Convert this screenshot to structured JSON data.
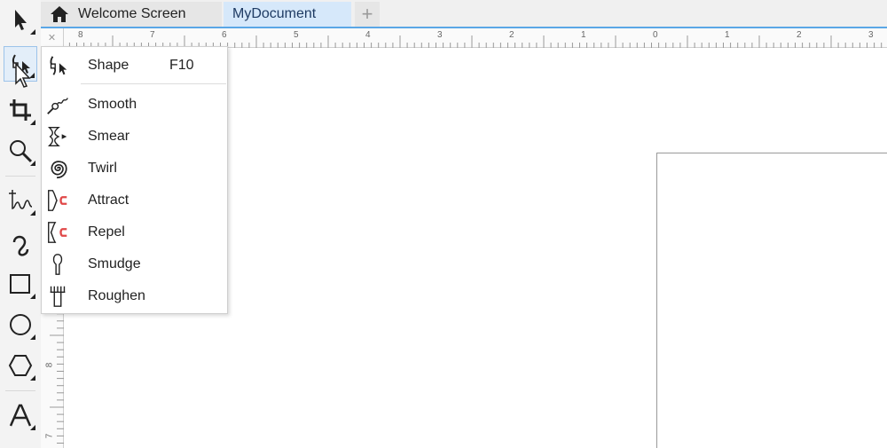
{
  "tabs": [
    {
      "label": "Welcome Screen",
      "icon": "home-icon"
    },
    {
      "label": "MyDocument"
    },
    {
      "label": "+",
      "icon": "add-tab-icon"
    }
  ],
  "ruler": {
    "top_numbers": [
      "8",
      "7",
      "6",
      "5",
      "4",
      "3",
      "2",
      "1",
      "0",
      "1",
      "2",
      "3"
    ],
    "left_numbers": [
      "8",
      "7"
    ]
  },
  "toolbox": [
    {
      "name": "pick-tool",
      "icon": "arrow-pointer-icon"
    },
    {
      "name": "shape-tool",
      "icon": "shape-node-icon",
      "active": true
    },
    {
      "name": "crop-tool",
      "icon": "crop-icon"
    },
    {
      "name": "zoom-tool",
      "icon": "magnifier-icon"
    },
    {
      "name": "freehand-tool",
      "icon": "freehand-icon"
    },
    {
      "name": "artistic-media-tool",
      "icon": "curve-icon"
    },
    {
      "name": "rectangle-tool",
      "icon": "rectangle-icon"
    },
    {
      "name": "ellipse-tool",
      "icon": "ellipse-icon"
    },
    {
      "name": "polygon-tool",
      "icon": "hexagon-icon"
    },
    {
      "name": "text-tool",
      "icon": "text-a-icon"
    }
  ],
  "flyout": {
    "items": [
      {
        "label": "Shape",
        "shortcut": "F10",
        "icon": "shape-node-icon"
      },
      {
        "label": "Smooth",
        "icon": "smooth-icon"
      },
      {
        "label": "Smear",
        "icon": "smear-icon"
      },
      {
        "label": "Twirl",
        "icon": "twirl-icon"
      },
      {
        "label": "Attract",
        "icon": "attract-magnet-icon"
      },
      {
        "label": "Repel",
        "icon": "repel-magnet-icon"
      },
      {
        "label": "Smudge",
        "icon": "smudge-icon"
      },
      {
        "label": "Roughen",
        "icon": "roughen-icon"
      }
    ]
  },
  "colors": {
    "accent": "#5aa7e6",
    "magnet": "#e04848",
    "active_tab": "#d6e8fa"
  }
}
